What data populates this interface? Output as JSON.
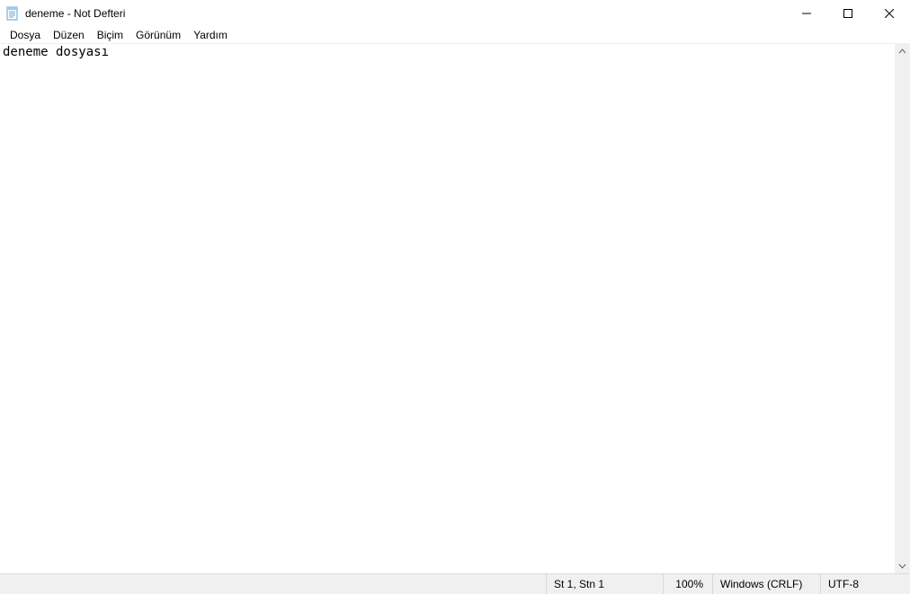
{
  "title": "deneme - Not Defteri",
  "menu": {
    "file": "Dosya",
    "edit": "Düzen",
    "format": "Biçim",
    "view": "Görünüm",
    "help": "Yardım"
  },
  "editor": {
    "content": "deneme dosyası"
  },
  "status": {
    "position": "St 1, Stn 1",
    "zoom": "100%",
    "eol": "Windows (CRLF)",
    "encoding": "UTF-8"
  }
}
